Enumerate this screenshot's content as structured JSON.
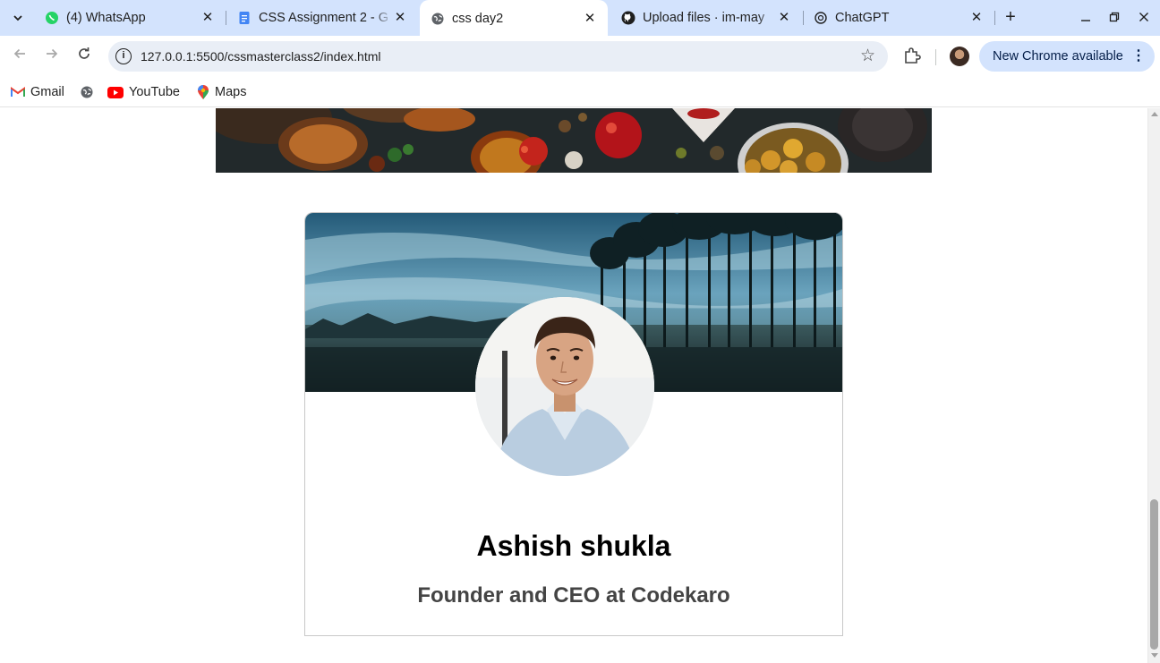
{
  "browser": {
    "tabs": [
      {
        "title": "(4) WhatsApp",
        "icon": "whatsapp-icon",
        "active": false
      },
      {
        "title": "CSS Assignment 2 - G",
        "icon": "google-docs-icon",
        "active": false
      },
      {
        "title": "css day2",
        "icon": "globe-icon",
        "active": true
      },
      {
        "title": "Upload files · im-may",
        "icon": "github-icon",
        "active": false
      },
      {
        "title": "ChatGPT",
        "icon": "chatgpt-icon",
        "active": false
      }
    ],
    "url": "127.0.0.1:5500/cssmasterclass2/index.html",
    "update_button": "New Chrome available",
    "bookmarks": [
      {
        "label": "Gmail",
        "icon": "gmail-icon"
      },
      {
        "label": "",
        "icon": "globe-icon"
      },
      {
        "label": "YouTube",
        "icon": "youtube-icon"
      },
      {
        "label": "Maps",
        "icon": "maps-icon"
      }
    ]
  },
  "page": {
    "card": {
      "name": "Ashish shukla",
      "role": "Founder and CEO at Codekaro"
    }
  },
  "colors": {
    "tabstrip_bg": "#d3e3fd",
    "omnibox_bg": "#e9eef6",
    "update_pill_bg": "#d3e3fd"
  }
}
